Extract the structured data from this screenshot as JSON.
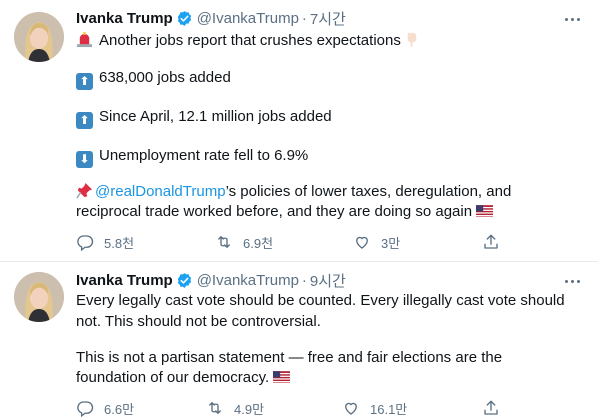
{
  "tweets": [
    {
      "display_name": "Ivanka Trump",
      "handle": "@IvankaTrump",
      "separator": "·",
      "time": "7시간",
      "lines": [
        "Another jobs report that crushes expectations",
        "638,000 jobs added",
        "Since April, 12.1 million jobs added",
        "Unemployment rate fell to 6.9%",
        "@realDonaldTrump",
        "’s policies of lower taxes, deregulation, and",
        "reciprocal trade worked before, and they are doing so again"
      ],
      "icons": {
        "line1": "rotating-light-emoji",
        "line1_end": "pointing-down-emoji",
        "line2": "arrow-up-emoji",
        "line3": "arrow-up-emoji",
        "line4": "arrow-down-emoji",
        "line5": "pushpin-emoji",
        "line6_end": "us-flag-emoji"
      },
      "arrow_up_glyph": "⬆",
      "arrow_down_glyph": "⬇",
      "stats": {
        "replies": "5.8천",
        "retweets": "6.9천",
        "likes": "3만"
      }
    },
    {
      "display_name": "Ivanka Trump",
      "handle": "@IvankaTrump",
      "separator": "·",
      "time": "9시간",
      "lines": [
        "Every legally cast vote should be counted. Every illegally cast vote should",
        "not. This should not be controversial.",
        "This is not a partisan statement — free and fair elections are the",
        "foundation of our democracy."
      ],
      "icons": {
        "line4_end": "us-flag-emoji"
      },
      "stats": {
        "replies": "6.6만",
        "retweets": "4.9만",
        "likes": "16.1만"
      }
    }
  ],
  "colors": {
    "text": "#0f1419",
    "secondary": "#5b7083",
    "link": "#1b95e0",
    "verified": "#1da1f2",
    "divider": "#e6ecf0",
    "emoji_box": "#3b88c3"
  }
}
